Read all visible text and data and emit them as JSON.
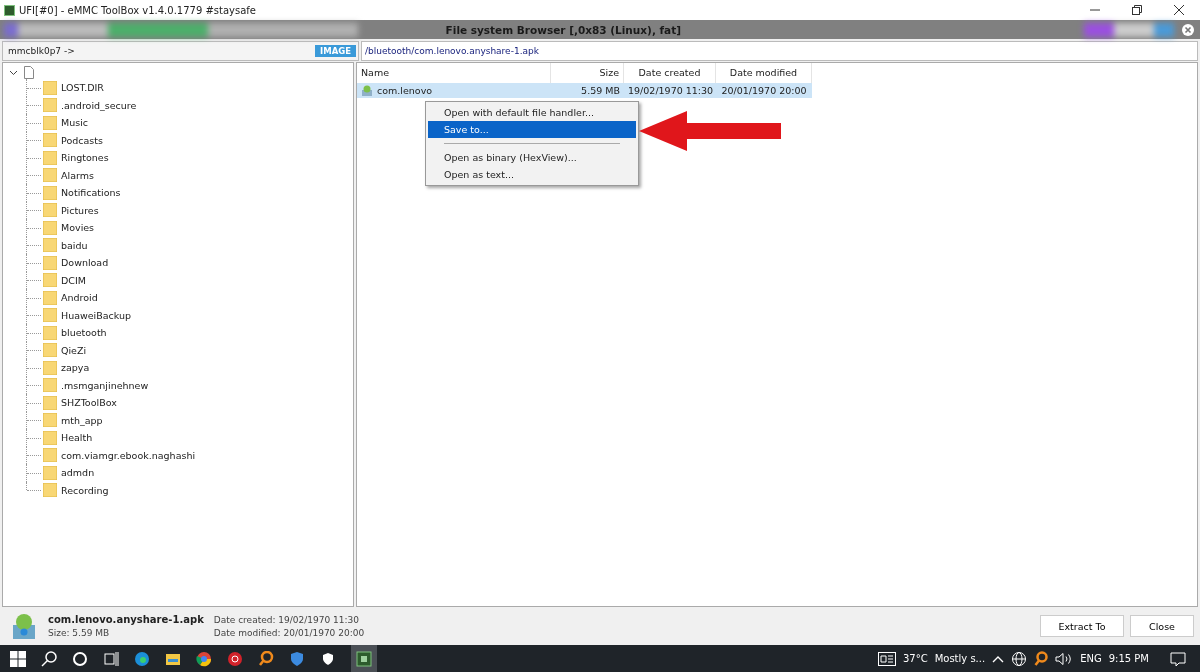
{
  "window": {
    "title": "UFI[#0] - eMMC ToolBox v1.4.0.1779 #staysafe"
  },
  "panel": {
    "title": "File system Browser [,0x83 (Linux), fat]"
  },
  "path_bar": {
    "device": "mmcblk0p7 ->",
    "badge": "IMAGE",
    "path": "/bluetooth/com.lenovo.anyshare-1.apk"
  },
  "tree": {
    "expanded": true,
    "children": [
      {
        "label": "LOST.DIR"
      },
      {
        "label": ".android_secure"
      },
      {
        "label": "Music"
      },
      {
        "label": "Podcasts"
      },
      {
        "label": "Ringtones"
      },
      {
        "label": "Alarms"
      },
      {
        "label": "Notifications"
      },
      {
        "label": "Pictures"
      },
      {
        "label": "Movies"
      },
      {
        "label": "baidu"
      },
      {
        "label": "Download"
      },
      {
        "label": "DCIM"
      },
      {
        "label": "Android"
      },
      {
        "label": "HuaweiBackup"
      },
      {
        "label": "bluetooth"
      },
      {
        "label": "QieZi"
      },
      {
        "label": "zapya"
      },
      {
        "label": ".msmganjinehnew"
      },
      {
        "label": "SHZToolBox"
      },
      {
        "label": "mth_app"
      },
      {
        "label": "Health"
      },
      {
        "label": "com.viamgr.ebook.naghashi"
      },
      {
        "label": "admdn"
      },
      {
        "label": "Recording"
      }
    ]
  },
  "table": {
    "columns": [
      "Name",
      "Size",
      "Date created",
      "Date modified"
    ],
    "rows": [
      {
        "name": "com.lenovo",
        "size": "5.59 MB",
        "date_created": "19/02/1970 11:30",
        "date_modified": "20/01/1970 20:00",
        "selected": true
      }
    ]
  },
  "context_menu": [
    {
      "kind": "item",
      "label": "Open with default file handler...",
      "selected": false
    },
    {
      "kind": "item",
      "label": "Save to...",
      "selected": true
    },
    {
      "kind": "separator"
    },
    {
      "kind": "item",
      "label": "Open as binary (HexView)...",
      "selected": false
    },
    {
      "kind": "item",
      "label": "Open as text...",
      "selected": false
    }
  ],
  "details": {
    "name": "com.lenovo.anyshare-1.apk",
    "size": "Size: 5.59 MB",
    "created": "Date created: 19/02/1970 11:30",
    "modified": "Date modified: 20/01/1970 20:00"
  },
  "buttons": [
    "Extract To",
    "Close"
  ],
  "taskbar": {
    "weather_temp": "37°C",
    "weather_text": "Mostly s...",
    "language": "ENG",
    "time": "9:15 PM"
  }
}
